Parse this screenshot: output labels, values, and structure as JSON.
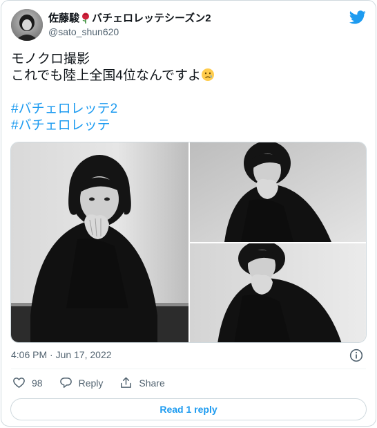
{
  "author": {
    "display_name_prefix": "佐藤駿",
    "emoji": "rose-emoji",
    "display_name_suffix": "バチェロレッテシーズン2",
    "handle": "@sato_shun620"
  },
  "tweet": {
    "lines": [
      "モノクロ撮影",
      "これでも陸上全国4位なんですよ"
    ],
    "emoji": "crying-face-emoji",
    "hashtags": [
      "#バチェロレッテ2",
      "#バチェロレッテ"
    ]
  },
  "meta": {
    "timestamp": "4:06 PM · Jun 17, 2022"
  },
  "actions": {
    "like_count": "98",
    "reply_label": "Reply",
    "share_label": "Share"
  },
  "read_replies_label": "Read 1 reply",
  "colors": {
    "accent": "#1d9bf0",
    "text": "#0f1419",
    "secondary": "#536471",
    "border": "#cfd9de"
  }
}
